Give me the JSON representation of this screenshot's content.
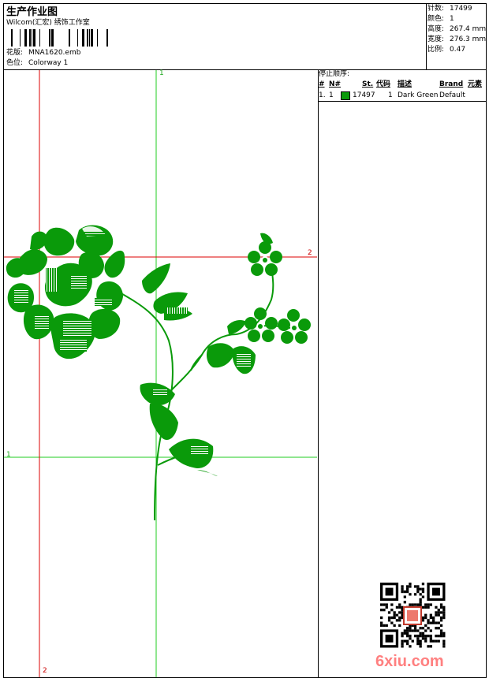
{
  "header": {
    "title": "生产作业图",
    "company": "Wilcom(汇宏) 绣饰工作室",
    "design_label": "花版:",
    "design_value": "MNA1620.emb",
    "colorway_label": "色位:",
    "colorway_value": "Colorway 1"
  },
  "stats": [
    {
      "label": "针数:",
      "value": "17499"
    },
    {
      "label": "颜色:",
      "value": "1"
    },
    {
      "label": "高度:",
      "value": "267.4 mm"
    },
    {
      "label": "宽度:",
      "value": "276.3 mm"
    },
    {
      "label": "比例:",
      "value": "0.47"
    }
  ],
  "stop_sequence": {
    "title": "停止顺序:",
    "columns": [
      "#",
      "N#",
      "St.",
      "代码",
      "描述",
      "Brand",
      "元素"
    ],
    "rows": [
      {
        "index": "1.",
        "needle": "1",
        "color": "#0a9a0a",
        "code": "17497",
        "stitches": "1",
        "description": "Dark Green",
        "brand": "Default"
      }
    ]
  },
  "guides": {
    "top_label": "1",
    "right_label": "2",
    "left_label": "1",
    "bottom_label": "2"
  },
  "watermark": {
    "text": "6xiu.com"
  },
  "colors": {
    "guide_green": "#22cc22",
    "guide_red": "#dd0000",
    "embroidery": "#0a9a0a"
  }
}
